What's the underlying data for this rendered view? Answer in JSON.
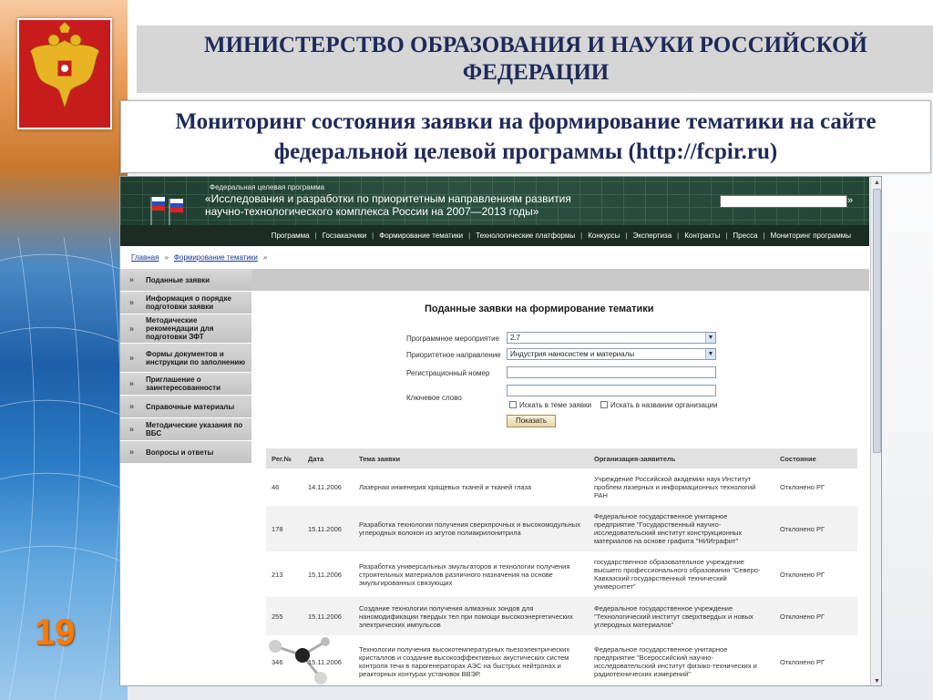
{
  "slide": {
    "ministry_title": "МИНИСТЕРСТВО ОБРАЗОВАНИЯ И НАУКИ РОССИЙСКОЙ ФЕДЕРАЦИИ",
    "subtitle": "Мониторинг состояния заявки на формирование тематики на сайте федеральной целевой программы (http://fcpir.ru)",
    "page_number": "19",
    "emblem_icon": "coat-of-arms-icon",
    "accent_color": "#ff7a00"
  },
  "site": {
    "program_small": "Федеральная целевая программа",
    "program_name": "«Исследования и разработки по приоритетным направлениям развития научно-технологического комплекса России на 2007—2013 годы»",
    "search_go": "»",
    "nav": [
      "Программа",
      "Госзаказчики",
      "Формирование тематики",
      "Технологические платформы",
      "Конкурсы",
      "Экспертиза",
      "Контракты",
      "Пресса",
      "Мониторинг программы"
    ],
    "breadcrumbs": [
      "Главная",
      "Формирование тематики"
    ],
    "breadcrumb_sep": "»",
    "sidebar": [
      "Поданные заявки",
      "Информация о порядке подготовки заявки",
      "Методические рекомендации для подготовки ЗФТ",
      "Формы документов и инструкции по заполнению",
      "Приглашение о заинтересованности",
      "Справочные материалы",
      "Методические указания по ВБС",
      "Вопросы и ответы"
    ],
    "sidebar_marker": "»",
    "form": {
      "title": "Поданные заявки на формирование тематики",
      "program_event_label": "Программное мероприятие",
      "program_event_value": "2.7",
      "priority_label": "Приоритетное направление",
      "priority_value": "Индустрия наносистем и материалы",
      "reg_number_label": "Регистрационный номер",
      "keyword_label": "Ключевое слово",
      "cb_theme_label": "Искать в теме заявки",
      "cb_org_label": "Искать в названии организации",
      "submit_label": "Показать"
    },
    "table": {
      "headers": [
        "Рег.№",
        "Дата",
        "Тема заявки",
        "Организация-заявитель",
        "Состояние"
      ],
      "rows": [
        [
          "46",
          "14.11.2006",
          "Лазерная инженерия хрящевых тканей и тканей глаза",
          "Учреждение Российской академии наук Институт проблем лазерных и информационных технологий РАН",
          "Отклонено РГ"
        ],
        [
          "178",
          "15.11.2006",
          "Разработка технологии получения сверхпрочных и высокомодульных углеродных волокон из жгутов полиакрилонитрила",
          "Федеральное государственное унитарное предприятие \"Государственный научно-исследовательский институт конструкционных материалов на основе графита \"НИИграфит\"",
          "Отклонено РГ"
        ],
        [
          "213",
          "15.11.2006",
          "Разработка универсальных эмульгаторов и технологии получения строительных материалов различного назначения на основе эмульгированных связующих",
          "государственное образовательное учреждение высшего профессионального образования \"Северо-Кавказский государственный технический университет\"",
          "Отклонено РГ"
        ],
        [
          "255",
          "15.11.2006",
          "Создание технологии получения алмазных зондов для наномодификации твердых тел при помощи высокоэнергетических электрических импульсов",
          "Федеральное государственное учреждение \"Технологический институт сверхтвердых и новых углеродных материалов\"",
          "Отклонено РГ"
        ],
        [
          "346",
          "15.11.2006",
          "Технологии получения высокотемпературных пьезоэлектрических кристаллов и создание высокоэффективных акустических систем контроля течи в парогенераторах АЭС на быстрых нейтронах и реакторных контурах установок ВВЭР.",
          "Федеральное государственное унитарное предприятие \"Всероссийский научно-исследовательский институт физико-технических и радиотехнических измерений\"",
          "Отклонено РГ"
        ]
      ]
    }
  }
}
